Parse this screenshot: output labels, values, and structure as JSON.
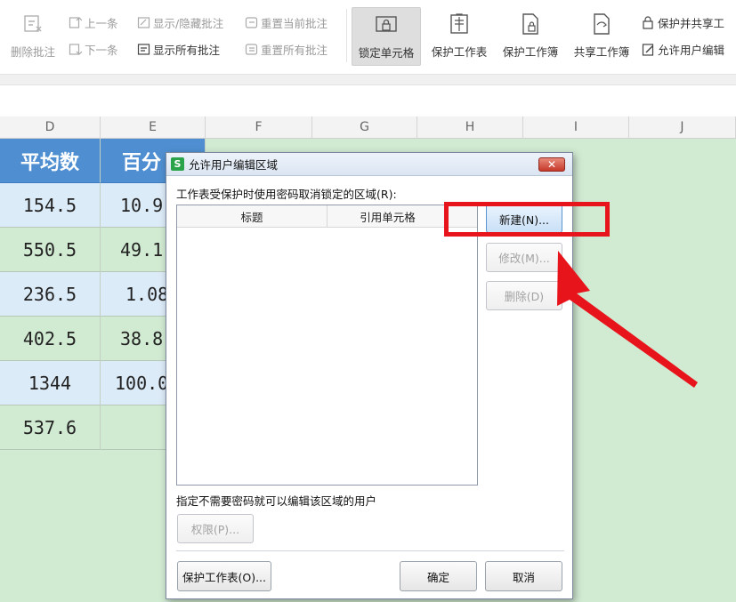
{
  "ribbon": {
    "delete_comment": "删除批注",
    "prev": "上一条",
    "next": "下一条",
    "show_hide_comment": "显示/隐藏批注",
    "show_all_comments": "显示所有批注",
    "reset_current_comment": "重置当前批注",
    "reset_all_comments": "重置所有批注",
    "lock_cell": "锁定单元格",
    "protect_sheet": "保护工作表",
    "protect_workbook": "保护工作簿",
    "share_workbook": "共享工作簿",
    "protect_and_share": "保护并共享工",
    "allow_users_edit": "允许用户编辑"
  },
  "sheet": {
    "columns": [
      "D",
      "E",
      "F",
      "G",
      "H",
      "I",
      "J"
    ],
    "header_row": {
      "d": "平均数",
      "e": "百分"
    },
    "rows": [
      {
        "d": "154.5",
        "e": "10.9"
      },
      {
        "d": "550.5",
        "e": "49.1"
      },
      {
        "d": "236.5",
        "e": "1.08"
      },
      {
        "d": "402.5",
        "e": "38.8"
      },
      {
        "d": "1344",
        "e": "100.0"
      },
      {
        "d": "537.6",
        "e": ""
      }
    ],
    "colors": {
      "header": "#4f8fd1",
      "blue_row": "#dcebf8",
      "green_row": "#d1ead2"
    }
  },
  "dialog": {
    "app_icon": "S",
    "title": "允许用户编辑区域",
    "close_label": "✕",
    "ranges_label": "工作表受保护时使用密码取消锁定的区域(R):",
    "list_columns": {
      "title": "标题",
      "ref": "引用单元格"
    },
    "btn_new": "新建(N)...",
    "btn_modify": "修改(M)...",
    "btn_delete": "删除(D)",
    "users_label": "指定不需要密码就可以编辑该区域的用户",
    "btn_permissions": "权限(P)...",
    "btn_protect_sheet": "保护工作表(O)...",
    "btn_ok": "确定",
    "btn_cancel": "取消"
  },
  "annotation": {
    "color": "#e8141c"
  }
}
